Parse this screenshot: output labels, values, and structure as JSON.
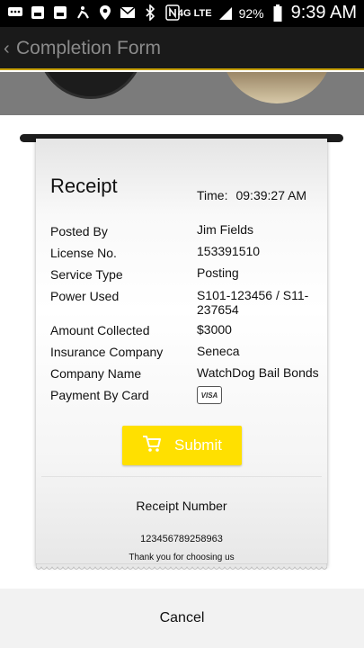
{
  "status_bar": {
    "battery_percent": "92%",
    "time": "9:39 AM",
    "network": "4G LTE",
    "icons": [
      "messages-icon",
      "gallery-icon",
      "gallery-icon",
      "wheelchair-icon",
      "location-icon",
      "mail-icon",
      "bluetooth-icon",
      "nfc-icon",
      "4g-lte-icon",
      "signal-icon",
      "battery-icon"
    ]
  },
  "app_bar": {
    "title": "Completion Form"
  },
  "receipt": {
    "title": "Receipt",
    "time_label": "Time:",
    "time_value": "09:39:27 AM",
    "rows": [
      {
        "label": "Posted By",
        "value": "Jim Fields"
      },
      {
        "label": "License No.",
        "value": "153391510"
      },
      {
        "label": "Service Type",
        "value": "Posting"
      },
      {
        "label": "Power Used",
        "value": "S101-123456 / S11-237654"
      },
      {
        "label": "Amount Collected",
        "value": "$3000"
      },
      {
        "label": "Insurance Company",
        "value": "Seneca"
      },
      {
        "label": "Company Name",
        "value": "WatchDog Bail Bonds"
      },
      {
        "label": "Payment By Card",
        "value": "VISA"
      }
    ],
    "submit_label": "Submit",
    "receipt_number_label": "Receipt Number",
    "receipt_number": "123456789258963",
    "thanks_text": "Thank you for choosing us"
  },
  "cancel_label": "Cancel",
  "colors": {
    "accent_yellow": "#ffe000",
    "app_bar_bg": "#1a1a1a",
    "app_bar_underline": "#c8a200"
  }
}
